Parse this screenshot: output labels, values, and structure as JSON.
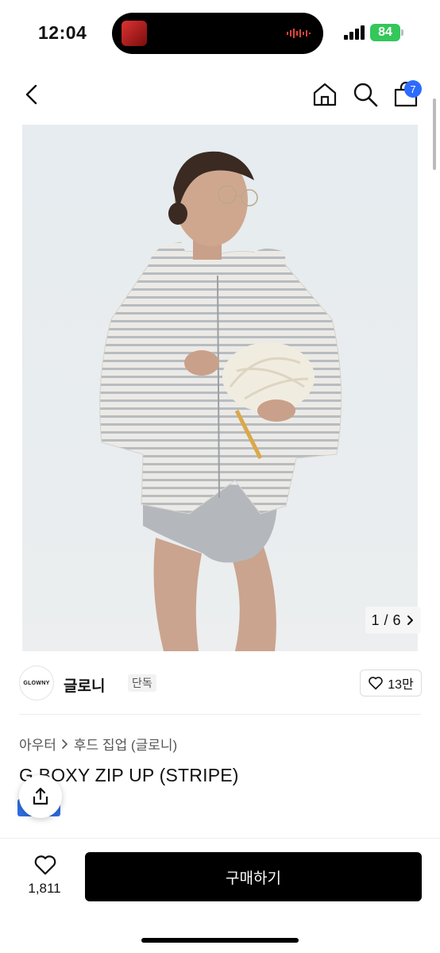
{
  "status": {
    "time": "12:04",
    "battery": "84"
  },
  "nav": {
    "cart_count": "7"
  },
  "gallery": {
    "current": "1",
    "separator": "/",
    "total": "6"
  },
  "brand": {
    "logo_text": "GLOWNY",
    "name": "글로니",
    "tag": "단독",
    "likes": "13만"
  },
  "breadcrumb": [
    "아우터",
    "후드 집업 (글로니)"
  ],
  "product": {
    "title": "G BOXY ZIP UP (STRIPE)"
  },
  "bottom": {
    "wish_count": "1,811",
    "buy_label": "구매하기"
  },
  "colors": {
    "accent": "#2d6bff",
    "buy_bg": "#000000",
    "battery": "#34c759"
  },
  "icons": [
    "chevron-left-icon",
    "home-icon",
    "search-icon",
    "bag-icon",
    "heart-icon",
    "share-icon",
    "chevron-right-icon"
  ]
}
